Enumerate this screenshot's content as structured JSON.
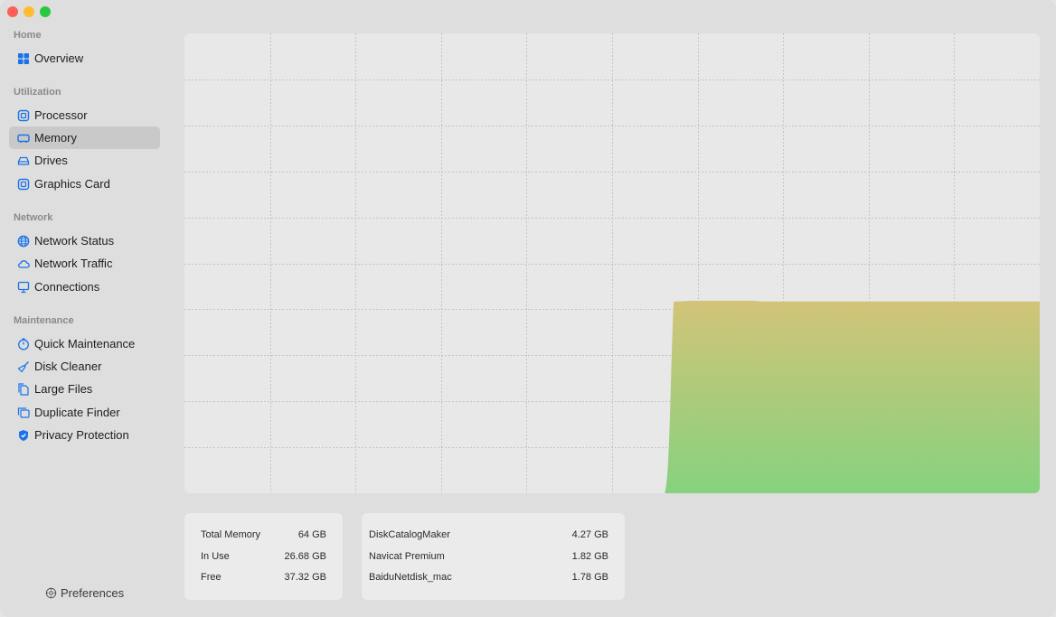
{
  "window": {
    "traffic_colors": [
      "#ff5f57",
      "#febc2e",
      "#28c840"
    ]
  },
  "sidebar": {
    "sections": [
      {
        "title": "Home"
      },
      {
        "title": "Utilization"
      },
      {
        "title": "Network"
      },
      {
        "title": "Maintenance"
      }
    ],
    "items": [
      {
        "label": "Overview",
        "icon": "grid-icon"
      },
      {
        "label": "Processor",
        "icon": "chip-icon"
      },
      {
        "label": "Memory",
        "icon": "memory-icon",
        "active": true
      },
      {
        "label": "Drives",
        "icon": "drive-icon"
      },
      {
        "label": "Graphics Card",
        "icon": "gpu-icon"
      },
      {
        "label": "Network Status",
        "icon": "globe-icon"
      },
      {
        "label": "Network Traffic",
        "icon": "cloud-icon"
      },
      {
        "label": "Connections",
        "icon": "monitor-icon"
      },
      {
        "label": "Quick Maintenance",
        "icon": "timer-icon"
      },
      {
        "label": "Disk Cleaner",
        "icon": "broom-icon"
      },
      {
        "label": "Large Files",
        "icon": "documents-icon"
      },
      {
        "label": "Duplicate Finder",
        "icon": "duplicate-icon"
      },
      {
        "label": "Privacy Protection",
        "icon": "shield-icon"
      }
    ],
    "preferences_label": "Preferences",
    "accent_color": "#1a73e8"
  },
  "chart_data": {
    "type": "area",
    "title": "",
    "xlabel": "",
    "ylabel": "",
    "grid": true,
    "ylim": [
      0,
      64
    ],
    "x_count": 60,
    "series": [
      {
        "values": [
          0,
          0,
          0,
          0,
          0,
          0,
          0,
          0,
          0,
          0,
          0,
          0,
          0,
          0,
          0,
          0,
          0,
          0,
          0,
          0,
          0,
          0,
          0,
          0,
          0,
          0,
          0,
          0,
          0,
          0,
          0,
          0,
          0,
          0,
          26.7,
          26.8,
          26.8,
          26.8,
          26.8,
          26.8,
          26.7,
          26.7,
          26.7,
          26.7,
          26.7,
          26.7,
          26.7,
          26.7,
          26.7,
          26.7,
          26.7,
          26.7,
          26.7,
          26.7,
          26.7,
          26.7,
          26.7,
          26.7,
          26.7,
          26.68
        ]
      }
    ],
    "colors": {
      "top": "#d2c478",
      "bottom": "#86d27e",
      "grid": "#c4c4c4"
    }
  },
  "memory_stats": [
    {
      "label": "Total Memory",
      "value": "64 GB"
    },
    {
      "label": "In Use",
      "value": "26.68 GB"
    },
    {
      "label": "Free",
      "value": "37.32 GB"
    }
  ],
  "top_processes": [
    {
      "name": "DiskCatalogMaker",
      "value": "4.27 GB"
    },
    {
      "name": "Navicat Premium",
      "value": "1.82 GB"
    },
    {
      "name": "BaiduNetdisk_mac",
      "value": "1.78 GB"
    }
  ]
}
